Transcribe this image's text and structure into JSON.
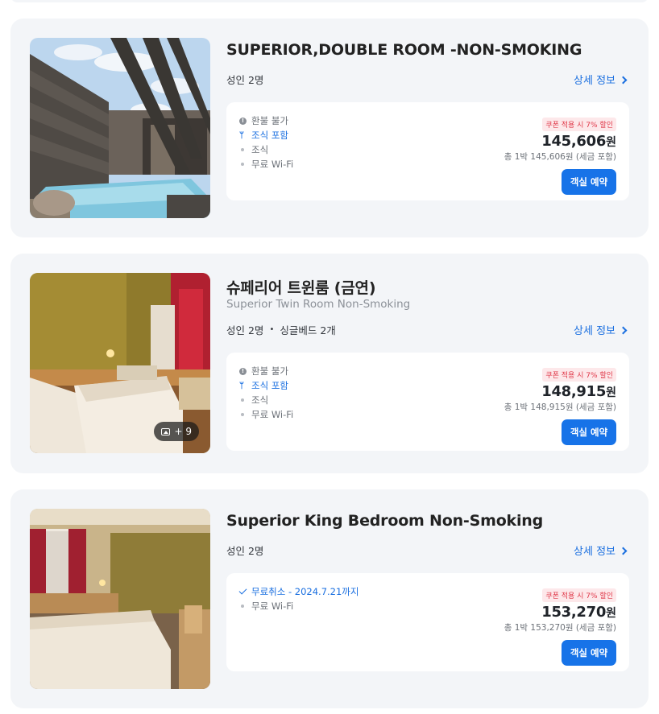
{
  "rooms": [
    {
      "title": "SUPERIOR,DOUBLE ROOM -NON-SMOKING",
      "subtitle": "",
      "capacity": "성인 2명",
      "bed": "",
      "detail_label": "상세 정보",
      "photo_count": "",
      "policies": [
        {
          "text": "환불 불가",
          "icon": "info-icon",
          "style": "muted"
        },
        {
          "text": "조식 포함",
          "icon": "meal-icon",
          "style": "blue"
        },
        {
          "text": "조식",
          "icon": "bullet-icon",
          "style": "muted"
        },
        {
          "text": "무료 Wi-Fi",
          "icon": "bullet-icon",
          "style": "muted"
        }
      ],
      "coupon": "쿠폰 적용 시 7% 할인",
      "price": "145,606",
      "currency": "원",
      "total": "총 1박 145,606원 (세금 포함)",
      "book_label": "객실 예약"
    },
    {
      "title": "슈페리어 트윈룸 (금연)",
      "subtitle": "Superior Twin Room Non-Smoking",
      "capacity": "성인 2명",
      "bed": "싱글베드 2개",
      "detail_label": "상세 정보",
      "photo_count": "+ 9",
      "policies": [
        {
          "text": "환불 불가",
          "icon": "info-icon",
          "style": "muted"
        },
        {
          "text": "조식 포함",
          "icon": "meal-icon",
          "style": "blue"
        },
        {
          "text": "조식",
          "icon": "bullet-icon",
          "style": "muted"
        },
        {
          "text": "무료 Wi-Fi",
          "icon": "bullet-icon",
          "style": "muted"
        }
      ],
      "coupon": "쿠폰 적용 시 7% 할인",
      "price": "148,915",
      "currency": "원",
      "total": "총 1박 148,915원 (세금 포함)",
      "book_label": "객실 예약"
    },
    {
      "title": "Superior King Bedroom Non-Smoking",
      "subtitle": "",
      "capacity": "성인 2명",
      "bed": "",
      "detail_label": "상세 정보",
      "photo_count": "",
      "policies": [
        {
          "text": "무료취소 - 2024.7.21까지",
          "icon": "check-icon",
          "style": "blue"
        },
        {
          "text": "무료 Wi-Fi",
          "icon": "bullet-icon",
          "style": "muted"
        }
      ],
      "coupon": "쿠폰 적용 시 7% 할인",
      "price": "153,270",
      "currency": "원",
      "total": "총 1박 153,270원 (세금 포함)",
      "book_label": "객실 예약"
    }
  ],
  "colors": {
    "accent": "#1773e8",
    "link": "#1a6fe0",
    "coupon_text": "#e0394a",
    "coupon_bg": "#fde8ea",
    "card_bg": "#f3f5f8"
  }
}
